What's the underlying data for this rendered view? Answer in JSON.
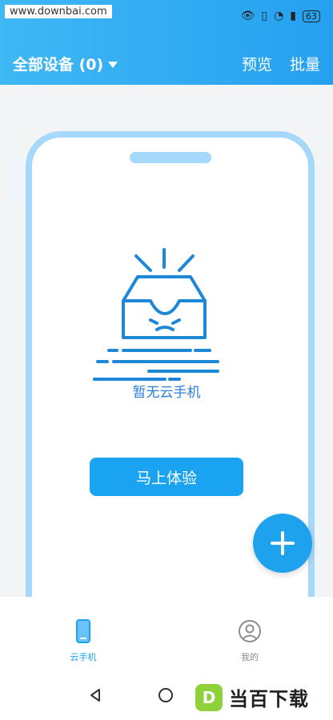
{
  "status": {
    "watermark": "www.downbai.com",
    "battery": "63"
  },
  "header": {
    "device_title": "全部设备 (0)",
    "preview_label": "预览",
    "batch_label": "批量"
  },
  "main": {
    "empty_text": "暂无云手机",
    "try_now_label": "马上体验"
  },
  "bottom_nav": {
    "items": [
      {
        "label": "云手机",
        "active": true
      },
      {
        "label": "我的",
        "active": false
      }
    ]
  },
  "brand": {
    "text": "当百下载",
    "mark": "D"
  },
  "colors": {
    "accent": "#1aa3f0",
    "header_start": "#3fb8f5",
    "header_end": "#25a0f0",
    "phone_frame": "#a6d8fb",
    "empty_text": "#2b7fd9",
    "brand_green": "#8fd13a"
  },
  "icons": {
    "fab": "plus-icon",
    "nav_phone": "phone-icon",
    "nav_me": "user-circle-icon",
    "back": "back-triangle-icon",
    "home": "home-circle-icon"
  }
}
